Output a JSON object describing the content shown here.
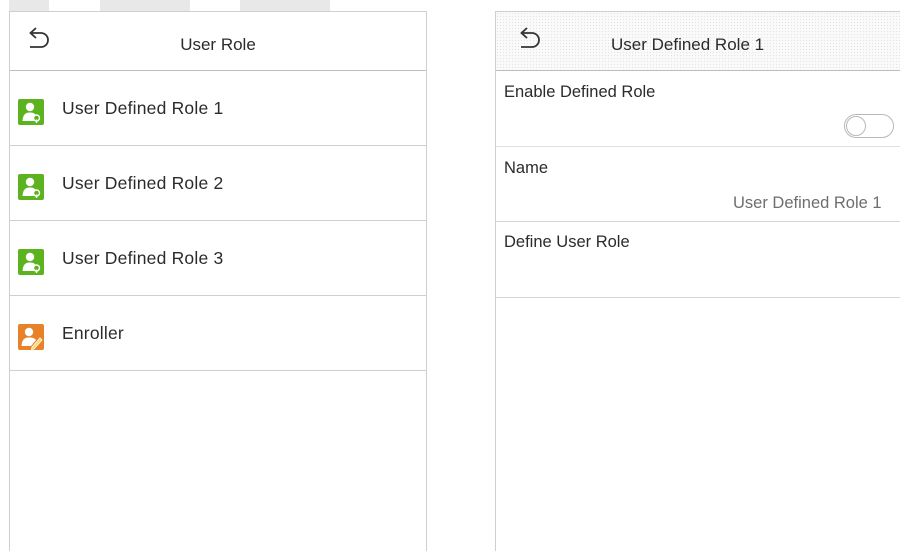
{
  "left_screen": {
    "title": "User Role",
    "back_icon": "undo-arrow-icon",
    "roles": [
      {
        "label": "User Defined Role 1",
        "icon": "user-key-icon",
        "icon_color": "#5cb31f"
      },
      {
        "label": "User Defined Role 2",
        "icon": "user-key-icon",
        "icon_color": "#5cb31f"
      },
      {
        "label": "User Defined Role 3",
        "icon": "user-key-icon",
        "icon_color": "#5cb31f"
      },
      {
        "label": "Enroller",
        "icon": "user-edit-icon",
        "icon_color": "#e8822a"
      }
    ]
  },
  "right_screen": {
    "title": "User Defined Role 1",
    "back_icon": "undo-arrow-icon",
    "enable_defined_role": {
      "label": "Enable Defined Role",
      "enabled": false
    },
    "name": {
      "label": "Name",
      "value": "User Defined Role 1"
    },
    "define_user_role": {
      "label": "Define User Role"
    }
  }
}
